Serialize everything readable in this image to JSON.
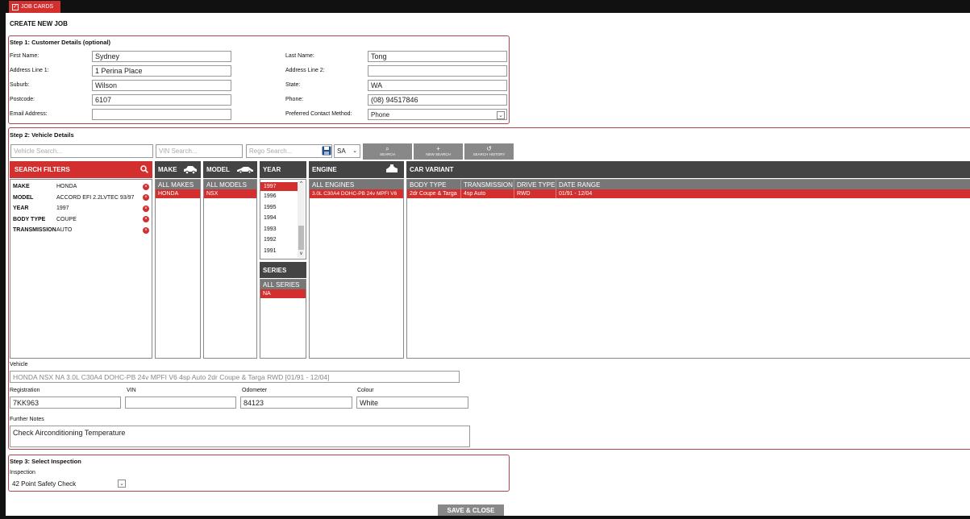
{
  "tab": {
    "label": "JOB CARDS"
  },
  "page_title": "CREATE NEW JOB",
  "step1": {
    "title": "Step 1: Customer Details (optional)",
    "first_name": {
      "label": "First Name:",
      "value": "Sydney"
    },
    "last_name": {
      "label": "Last Name:",
      "value": "Tong"
    },
    "address1": {
      "label": "Address Line 1:",
      "value": "1 Perina Place"
    },
    "address2": {
      "label": "Address Line 2:",
      "value": ""
    },
    "suburb": {
      "label": "Suburb:",
      "value": "Wilson"
    },
    "state": {
      "label": "State:",
      "value": "WA"
    },
    "postcode": {
      "label": "Postcode:",
      "value": "6107"
    },
    "phone": {
      "label": "Phone:",
      "value": "(08) 94517846"
    },
    "email": {
      "label": "Email Address:",
      "value": ""
    },
    "contact": {
      "label": "Preferred Contact Method:",
      "value": "Phone"
    }
  },
  "step2": {
    "title": "Step 2: Vehicle Details",
    "vehicle_search_placeholder": "Vehicle Search...",
    "vin_search_placeholder": "VIN Search...",
    "rego_search_placeholder": "Rego Search...",
    "state_select": "SA",
    "search_btn": "SEARCH",
    "new_search_btn": "NEW SEARCH",
    "history_btn": "SEARCH HISTORY",
    "filters_title": "SEARCH FILTERS",
    "filters": [
      {
        "key": "MAKE",
        "value": "HONDA"
      },
      {
        "key": "MODEL",
        "value": "ACCORD EFI 2.2LVTEC 93/97"
      },
      {
        "key": "YEAR",
        "value": "1997"
      },
      {
        "key": "BODY TYPE",
        "value": "COUPE"
      },
      {
        "key": "TRANSMISSION",
        "value": "AUTO"
      }
    ],
    "make": {
      "title": "MAKE",
      "all": "ALL MAKES",
      "selected": "HONDA"
    },
    "model": {
      "title": "MODEL",
      "all": "ALL MODELS",
      "selected": "NSX"
    },
    "year": {
      "title": "YEAR",
      "items": [
        "1997",
        "1996",
        "1995",
        "1994",
        "1993",
        "1992",
        "1991"
      ],
      "selected": "1997"
    },
    "series": {
      "title": "SERIES",
      "all": "ALL SERIES",
      "selected": "NA"
    },
    "engine": {
      "title": "ENGINE",
      "all": "ALL ENGINES",
      "selected": "3.0L C30A4 DOHC-PB 24v MPFI V6"
    },
    "variant": {
      "title": "CAR VARIANT",
      "columns": [
        "BODY TYPE",
        "TRANSMISSION",
        "DRIVE TYPE",
        "DATE RANGE"
      ],
      "row": [
        "2dr Coupe & Targa",
        "4sp Auto",
        "RWD",
        "01/91 - 12/04"
      ]
    },
    "vehicle": {
      "label": "Vehicle",
      "value": "HONDA NSX NA 3.0L C30A4 DOHC-PB 24v MPFI V6 4sp Auto 2dr Coupe & Targa RWD [01/91 - 12/04]"
    },
    "registration": {
      "label": "Registration",
      "value": "7KK963"
    },
    "vin": {
      "label": "VIN",
      "value": ""
    },
    "odometer": {
      "label": "Odometer",
      "value": "84123"
    },
    "colour": {
      "label": "Colour",
      "value": "White"
    },
    "notes": {
      "label": "Further Notes",
      "value": "Check Airconditioning Temperature"
    }
  },
  "step3": {
    "title": "Step 3: Select Inspection",
    "inspection_label": "Inspection",
    "inspection_value": "42 Point Safety Check"
  },
  "save_btn": "SAVE & CLOSE",
  "colors": {
    "accent": "#d32f2f",
    "dark": "#444444",
    "border": "#b0464e"
  }
}
